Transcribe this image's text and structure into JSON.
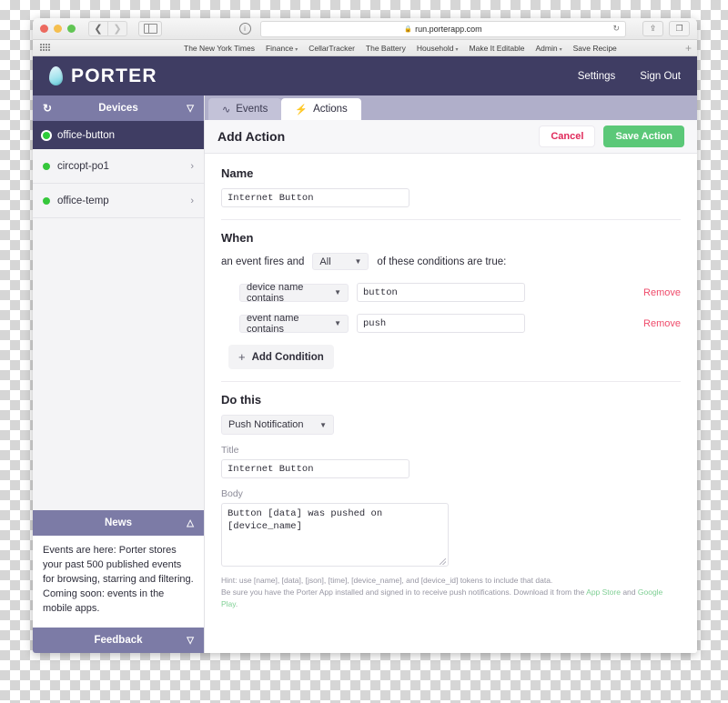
{
  "browser": {
    "url": "run.porterapp.com",
    "lock_icon": "lock-icon",
    "back_icon": "chevron-left-icon",
    "forward_icon": "chevron-right-icon",
    "sidebar_icon": "sidebar-toggle-icon",
    "info_icon": "info-icon",
    "reload_icon": "reload-icon",
    "share_icon": "share-icon",
    "tabs_icon": "show-tabs-icon",
    "new_tab_label": "+",
    "apps_icon": "apps-grid-icon",
    "bookmarks": [
      {
        "label": "The New York Times",
        "has_chevron": false
      },
      {
        "label": "Finance",
        "has_chevron": true
      },
      {
        "label": "CellarTracker",
        "has_chevron": false
      },
      {
        "label": "The Battery",
        "has_chevron": false
      },
      {
        "label": "Household",
        "has_chevron": true
      },
      {
        "label": "Make It Editable",
        "has_chevron": false
      },
      {
        "label": "Admin",
        "has_chevron": true
      },
      {
        "label": "Save Recipe",
        "has_chevron": false
      }
    ]
  },
  "app_header": {
    "brand": "PORTER",
    "logo_icon": "water-drop-logo",
    "settings_label": "Settings",
    "signout_label": "Sign Out"
  },
  "sidebar": {
    "devices_panel": {
      "title": "Devices",
      "refresh_icon": "refresh-icon",
      "collapse_icon": "chevron-down-icon"
    },
    "devices": [
      {
        "name": "office-button",
        "selected": true,
        "status_icon": "status-led-online",
        "arrow_icon": ""
      },
      {
        "name": "circopt-po1",
        "selected": false,
        "status_icon": "status-led-online",
        "arrow_icon": "chevron-right-icon"
      },
      {
        "name": "office-temp",
        "selected": false,
        "status_icon": "status-led-online",
        "arrow_icon": "chevron-right-icon"
      }
    ],
    "news_panel": {
      "title": "News",
      "toggle_icon": "chevron-up-icon",
      "body": "Events are here: Porter stores your past 500 published events for browsing, starring and filtering. Coming soon: events in the mobile apps."
    },
    "feedback_panel": {
      "title": "Feedback",
      "toggle_icon": "chevron-down-icon"
    }
  },
  "main": {
    "tabs": [
      {
        "label": "Events",
        "icon": "pulse-icon",
        "active": false
      },
      {
        "label": "Actions",
        "icon": "lightning-bolt-icon",
        "active": true
      }
    ],
    "action_header": {
      "title": "Add Action",
      "cancel_label": "Cancel",
      "save_label": "Save Action"
    },
    "name_section": {
      "label": "Name",
      "value": "Internet Button",
      "placeholder": "Name"
    },
    "when_section": {
      "label": "When",
      "prefix_text": "an event fires and",
      "match_value": "All",
      "suffix_text": "of these conditions are true:",
      "conditions": [
        {
          "type": "device name contains",
          "value": "button",
          "remove_label": "Remove"
        },
        {
          "type": "event name contains",
          "value": "push",
          "remove_label": "Remove"
        }
      ],
      "add_condition_label": "Add Condition",
      "add_icon": "plus-icon"
    },
    "do_section": {
      "label": "Do this",
      "action_value": "Push Notification",
      "title_label": "Title",
      "title_value": "Internet Button",
      "body_label": "Body",
      "body_value": "Button [data] was pushed on [device_name]",
      "hint_line_1": "Hint: use [name], [data], [json], [time], [device_name], and [device_id] tokens to include that data.",
      "hint_line_2_pre": "Be sure you have the Porter App installed and signed in to receive push notifications. Download it from the ",
      "hint_link_1": "App Store",
      "hint_line_2_mid": " and ",
      "hint_link_2": "Google Play",
      "hint_line_2_end": "."
    }
  },
  "colors": {
    "brand_dark": "#3f3d63",
    "panel_purple": "#7c7ba6",
    "tabbar": "#b0afca",
    "save_green": "#5bc878",
    "cancel_red": "#e0295a",
    "remove_red": "#ef4b6b",
    "led_green": "#35c73b",
    "link_green": "#7fcf94"
  }
}
